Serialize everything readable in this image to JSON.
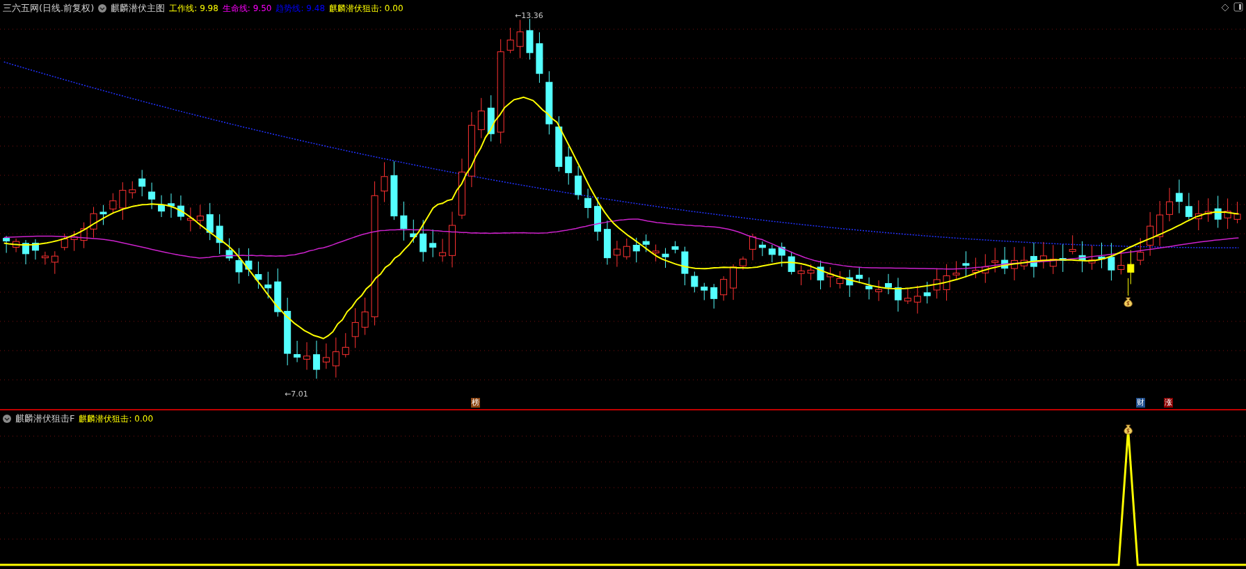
{
  "main_panel": {
    "source": "三六五网(日线.前复权)",
    "indicator": "麒麟潜伏主图",
    "values": [
      {
        "text": "工作线: 9.98",
        "color": "#ffff00"
      },
      {
        "text": "生命线: 9.50",
        "color": "#ff00ff"
      },
      {
        "text": "趋势线: 9.48",
        "color": "#0000ff"
      },
      {
        "text": "麒麟潜伏狙击: 0.00",
        "color": "#ffff00"
      }
    ],
    "price_marks": [
      {
        "text": "←13.36"
      },
      {
        "text": "←7.01"
      }
    ],
    "event_badges": [
      {
        "text": "榜",
        "color": "#8b4513"
      },
      {
        "text": "财",
        "color": "#1e4d8c"
      },
      {
        "text": "涨",
        "color": "#8b0000"
      }
    ]
  },
  "lower_panel": {
    "indicator": "麒麟潜伏狙击F",
    "values": [
      {
        "text": "麒麟潜伏狙击: 0.00",
        "color": "#ffff00"
      }
    ]
  }
}
